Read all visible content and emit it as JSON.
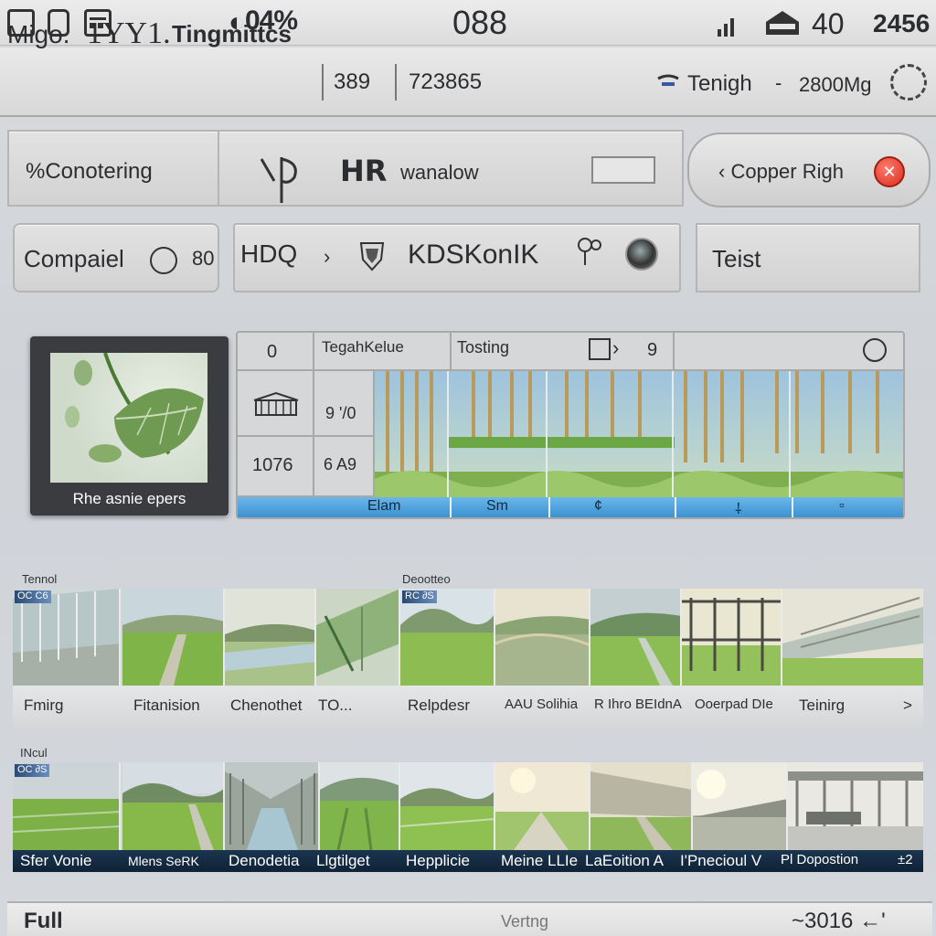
{
  "status_bar": {
    "battery_text": "04%",
    "clock": "088",
    "level": "40",
    "extra": "2456"
  },
  "header": {
    "app_name": "Migo.",
    "app_number": "1YY1.",
    "title": "Tingmittcs",
    "value_1": "389",
    "value_2": "723865",
    "control_label": "Tenigh",
    "control_sep": "-",
    "control_value": "2800Mg"
  },
  "toolbar_1": {
    "connecting_label": "%Conotering",
    "brand": "HR",
    "brand_sub": "wanalow",
    "copper_label": "Copper Righ",
    "copper_chevron": "‹"
  },
  "toolbar_2": {
    "compare_label": "Compaiel",
    "compare_number": "80",
    "breadcrumb_root": "HDQ",
    "breadcrumb_chevron": "›",
    "breadcrumb_current": "KDSKonIK",
    "test_label": "Teist"
  },
  "preview": {
    "caption": "Rhe asnie epers"
  },
  "grid": {
    "header": [
      "0",
      "TegahKelue",
      "Tosting",
      "9"
    ],
    "row_1_value": "9 '/0",
    "row_2_label": "1076",
    "row_2_value": "6 A9",
    "footer": [
      "Elam",
      "Sm",
      "¢",
      "⸸",
      "▫"
    ]
  },
  "strip_1": {
    "section_left": "Tennol",
    "section_right": "Deootteo",
    "badge_1": "OC C6",
    "badge_2": "RC ∂S",
    "labels": [
      "Fmirg",
      "Fitanision",
      "Chenothet",
      "TO...",
      "Relpdesr",
      "AAU Solihia",
      "R Ihro BEIdnA",
      "Ooerpad DIe",
      "Teinirg",
      ">"
    ]
  },
  "strip_2": {
    "section_label": "INcul",
    "badge": "OC ∂S",
    "labels": [
      "Sfer Vonie",
      "Mlens SeRK",
      "Denodetia",
      "Llgtilget",
      "Hepplicie",
      "Meine LLIe",
      "LaEoition A",
      "I'Pnecioul V",
      "Pl Dopostion",
      "±2"
    ]
  },
  "bottom_bar": {
    "left": "Full",
    "center": "Vertng",
    "right": "~3016 ←'"
  }
}
